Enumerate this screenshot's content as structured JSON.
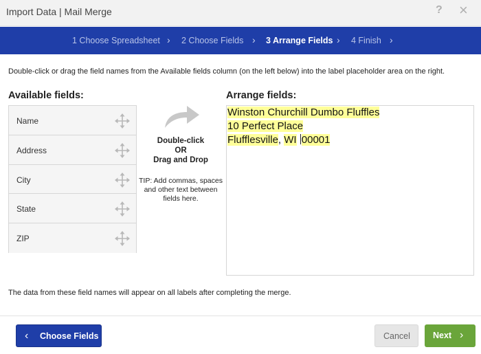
{
  "window": {
    "title": "Import Data | Mail Merge",
    "help_glyph": "?",
    "close_glyph": "×"
  },
  "steps": [
    {
      "label": "1 Choose Spreadsheet",
      "active": false
    },
    {
      "label": "2 Choose Fields",
      "active": false
    },
    {
      "label": "3 Arrange Fields",
      "active": true
    },
    {
      "label": "4 Finish",
      "active": false
    }
  ],
  "chevron_glyph": "›",
  "instructions": "Double-click or drag the field names from the Available fields column (on the left below) into the label placeholder area on the right.",
  "available": {
    "heading": "Available fields:",
    "fields": [
      "Name",
      "Address",
      "City",
      "State",
      "ZIP"
    ],
    "move_icon": "move-icon"
  },
  "middle": {
    "action_line1": "Double-click",
    "action_line2": "OR",
    "action_line3": "Drag and Drop",
    "tip": "TIP: Add commas, spaces and other text between fields here.",
    "arrow_icon": "curved-arrow-right-icon",
    "arrow_color": "#c8c8c8"
  },
  "arrange": {
    "heading": "Arrange fields:",
    "line1": "Winston Churchill Dumbo Fluffles",
    "line2": "10 Perfect Place",
    "line3_city": "Flufflesville",
    "line3_sep": ", ",
    "line3_state": "WI",
    "line3_space": " ",
    "line3_zip": "00001",
    "highlight_color": "#ffff99"
  },
  "footer_note": "The data from these field names will appear on all labels after completing the merge.",
  "buttons": {
    "back": "Choose Fields",
    "cancel": "Cancel",
    "next": "Next"
  },
  "colors": {
    "brand_blue": "#1f3ea8",
    "next_green": "#6aa53a"
  }
}
